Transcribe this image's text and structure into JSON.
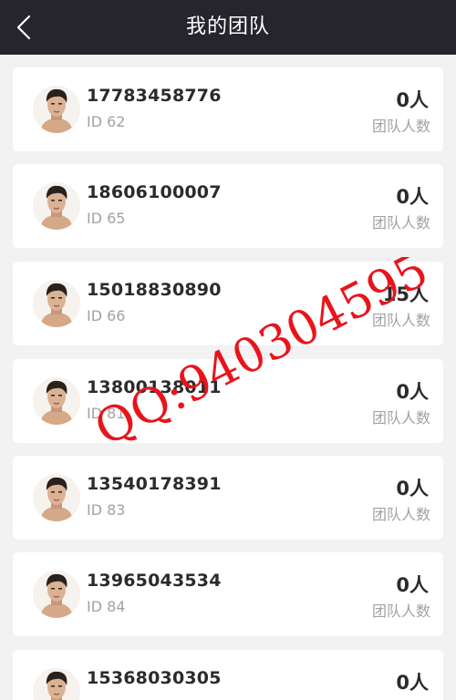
{
  "header": {
    "title": "我的团队",
    "back_icon": "chevron-left-icon"
  },
  "members": [
    {
      "phone": "17783458776",
      "id_text": "ID 62",
      "count": "0人",
      "count_label": "团队人数"
    },
    {
      "phone": "18606100007",
      "id_text": "ID 65",
      "count": "0人",
      "count_label": "团队人数"
    },
    {
      "phone": "15018830890",
      "id_text": "ID 66",
      "count": "15人",
      "count_label": "团队人数"
    },
    {
      "phone": "13800138011",
      "id_text": "ID 81",
      "count": "0人",
      "count_label": "团队人数"
    },
    {
      "phone": "13540178391",
      "id_text": "ID 83",
      "count": "0人",
      "count_label": "团队人数"
    },
    {
      "phone": "13965043534",
      "id_text": "ID 84",
      "count": "0人",
      "count_label": "团队人数"
    },
    {
      "phone": "15368030305",
      "id_text": "",
      "count": "0人",
      "count_label": ""
    }
  ],
  "watermark": {
    "text": "QQ:940304595",
    "color": "#e8141c"
  },
  "colors": {
    "header_bg": "#26252e",
    "page_bg": "#f2f2f2",
    "card_bg": "#ffffff",
    "primary_text": "#2b2b2b",
    "secondary_text": "#a2a2a2"
  }
}
